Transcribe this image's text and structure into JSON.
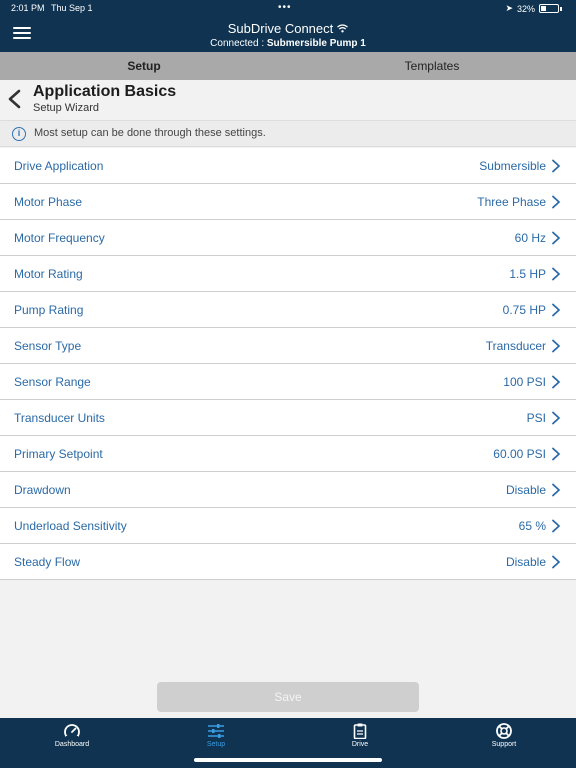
{
  "status_bar": {
    "time": "2:01 PM",
    "date": "Thu Sep 1",
    "battery": "32%"
  },
  "header": {
    "title": "SubDrive Connect",
    "connected_prefix": "Connected :",
    "connected_device": "Submersible Pump 1"
  },
  "tabs": [
    {
      "label": "Setup"
    },
    {
      "label": "Templates"
    }
  ],
  "page": {
    "title": "Application Basics",
    "subtitle": "Setup Wizard"
  },
  "info": {
    "text": "Most setup can be done through these settings."
  },
  "settings": [
    {
      "label": "Drive Application",
      "value": "Submersible"
    },
    {
      "label": "Motor Phase",
      "value": "Three Phase"
    },
    {
      "label": "Motor Frequency",
      "value": "60 Hz"
    },
    {
      "label": "Motor Rating",
      "value": "1.5 HP"
    },
    {
      "label": "Pump Rating",
      "value": "0.75 HP"
    },
    {
      "label": "Sensor Type",
      "value": "Transducer"
    },
    {
      "label": "Sensor Range",
      "value": "100 PSI"
    },
    {
      "label": "Transducer Units",
      "value": "PSI"
    },
    {
      "label": "Primary Setpoint",
      "value": "60.00 PSI"
    },
    {
      "label": "Drawdown",
      "value": "Disable"
    },
    {
      "label": "Underload Sensitivity",
      "value": "65 %"
    },
    {
      "label": "Steady Flow",
      "value": "Disable"
    }
  ],
  "save_label": "Save",
  "bottom_nav": [
    {
      "label": "Dashboard",
      "icon": "gauge-icon"
    },
    {
      "label": "Setup",
      "icon": "sliders-icon"
    },
    {
      "label": "Drive",
      "icon": "clipboard-icon"
    },
    {
      "label": "Support",
      "icon": "lifebuoy-icon"
    }
  ],
  "colors": {
    "header_bg": "#0f3350",
    "accent": "#2b6aa6",
    "active_nav": "#3a9de2"
  }
}
